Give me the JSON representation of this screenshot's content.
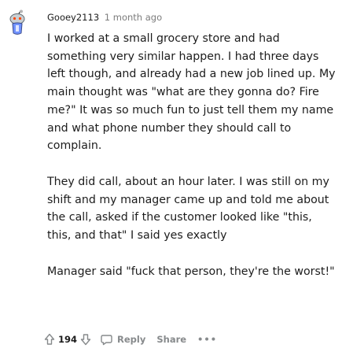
{
  "comment": {
    "avatar_icon": "snoo-avatar-icon",
    "username": "Gooey2113",
    "timestamp": "1 month ago",
    "paragraphs": [
      "I worked at a small grocery store and had something very similar happen. I had three days left though, and already had a new job lined up. My main thought was \"what are they gonna do? Fire me?\" It was so much fun to just tell them my name and what phone number they should call to complain.",
      "They did call, about an hour later. I was still on my shift and my manager came up and told me about the call, asked if the customer looked like \"this, this, and that\" I said yes exactly",
      "Manager said \"fuck that person, they're the worst!\""
    ]
  },
  "actions": {
    "upvote_icon": "upvote-arrow-icon",
    "vote_count": "194",
    "downvote_icon": "downvote-arrow-icon",
    "reply_icon": "speech-bubble-icon",
    "reply_label": "Reply",
    "share_label": "Share",
    "more_label": "•••"
  },
  "colors": {
    "text": "#1c1c1c",
    "meta": "#7c7c7c",
    "action": "#878a8c"
  }
}
